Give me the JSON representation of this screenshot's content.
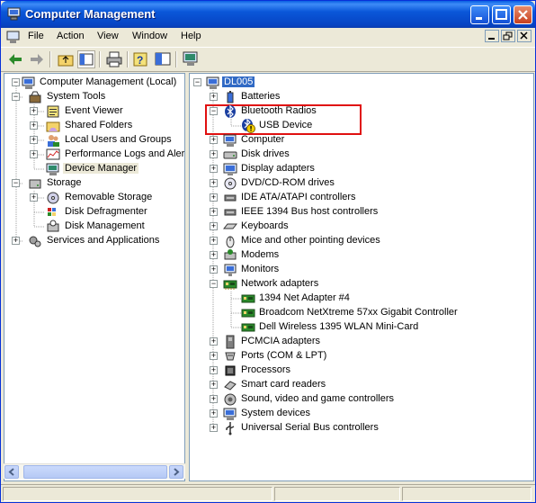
{
  "window": {
    "title": "Computer Management",
    "colors": {
      "titlebar": "#0a57d9",
      "selection": "#316ac5",
      "annotation": "#e01010"
    }
  },
  "menu": {
    "items": [
      "File",
      "Action",
      "View",
      "Window",
      "Help"
    ]
  },
  "toolbar": {
    "icons": [
      "back-arrow-icon",
      "forward-arrow-icon",
      "up-folder-icon",
      "show-hide-tree-icon",
      "print-icon",
      "help-icon",
      "properties-icon",
      "scan-hardware-icon"
    ]
  },
  "left_tree": {
    "root": "Computer Management (Local)",
    "system_tools": "System Tools",
    "event_viewer": "Event Viewer",
    "shared_folders": "Shared Folders",
    "local_users": "Local Users and Groups",
    "perf_logs": "Performance Logs and Alerts",
    "device_manager": "Device Manager",
    "storage": "Storage",
    "removable_storage": "Removable Storage",
    "disk_defrag": "Disk Defragmenter",
    "disk_management": "Disk Management",
    "services": "Services and Applications"
  },
  "device_tree": {
    "root": "DL005",
    "batteries": "Batteries",
    "bluetooth": "Bluetooth Radios",
    "usb_device": "USB Device",
    "computer": "Computer",
    "disk_drives": "Disk drives",
    "display": "Display adapters",
    "dvd": "DVD/CD-ROM drives",
    "ide": "IDE ATA/ATAPI controllers",
    "ieee": "IEEE 1394 Bus host controllers",
    "keyboards": "Keyboards",
    "mice": "Mice and other pointing devices",
    "modems": "Modems",
    "monitors": "Monitors",
    "network": "Network adapters",
    "net1": "1394 Net Adapter #4",
    "net2": "Broadcom NetXtreme 57xx Gigabit Controller",
    "net3": "Dell Wireless 1395 WLAN Mini-Card",
    "pcmcia": "PCMCIA adapters",
    "ports": "Ports (COM & LPT)",
    "processors": "Processors",
    "smart_card": "Smart card readers",
    "sound": "Sound, video and game controllers",
    "system_devices": "System devices",
    "usb_controllers": "Universal Serial Bus controllers"
  }
}
